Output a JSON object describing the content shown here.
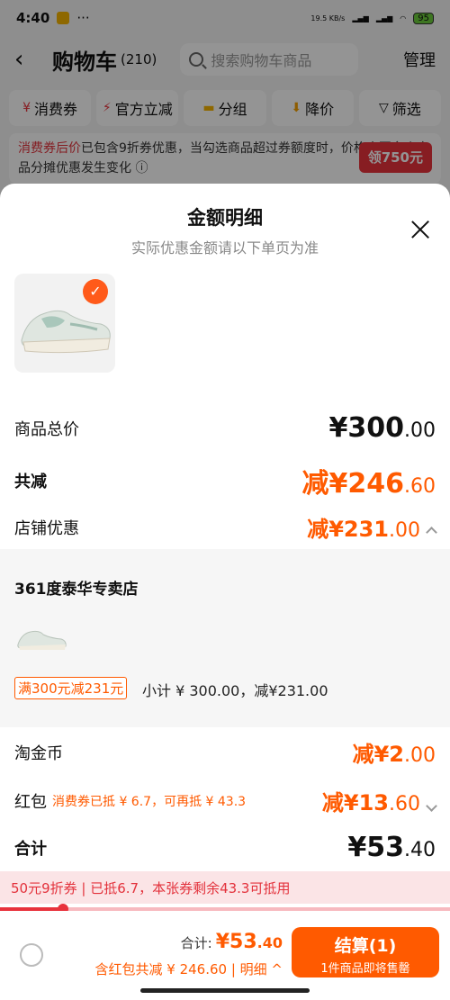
{
  "status": {
    "time": "4:40",
    "dots": "···",
    "speed": "19.5\nKB/s",
    "battery": "95"
  },
  "nav": {
    "back": "‹",
    "title": "购物车",
    "count": "(210)",
    "search_placeholder": "搜索购物车商品",
    "manage": "管理"
  },
  "filters": [
    {
      "icon": "¥",
      "label": "消费券"
    },
    {
      "icon": "⚡",
      "label": "官方立减"
    },
    {
      "icon": "▬",
      "label": "分组"
    },
    {
      "icon": "⬇",
      "label": "降价"
    },
    {
      "icon": "▽",
      "label": "筛选"
    }
  ],
  "notice": {
    "highlight": "消费券后价",
    "text": "已包含9折券优惠，当勾选商品超过券额度时，价格会因多个商品分摊优惠发生变化 ⓘ",
    "button": "领750元"
  },
  "sheet": {
    "title": "金额明细",
    "subtitle": "实际优惠金额请以下单页为准",
    "rows": {
      "total_label": "商品总价",
      "total_int": "¥300",
      "total_dec": ".00",
      "reduce_label": "共减",
      "reduce_int": "减¥246",
      "reduce_dec": ".60",
      "shop_label": "店铺优惠",
      "shop_int": "减¥231",
      "shop_dec": ".00",
      "coin_label": "淘金币",
      "coin_int": "减¥2",
      "coin_dec": ".00",
      "hb_label": "红包",
      "hb_note": "消费券已抵 ¥ 6.7，可再抵 ¥ 43.3",
      "hb_int": "减¥13",
      "hb_dec": ".60",
      "sum_label": "合计",
      "sum_int": "¥53",
      "sum_dec": ".40"
    },
    "shop_name": "361度泰华专卖店",
    "promo_tag": "满300元减231元",
    "subtotal": "小计 ¥ 300.00，减¥231.00"
  },
  "coupon_bar": "50元9折券 | 已抵6.7，本张券剩余43.3可抵用",
  "coupon_progress": 0.14,
  "bottom": {
    "total_label": "合计:",
    "total_int": "¥53",
    "total_dec": ".40",
    "discount": "含红包共减 ¥ 246.60 | 明细 ^",
    "checkout": "结算(1)",
    "checkout_sub": "1件商品即将售罄"
  },
  "colors": {
    "accent": "#ff5a00",
    "red": "#e8323c"
  }
}
